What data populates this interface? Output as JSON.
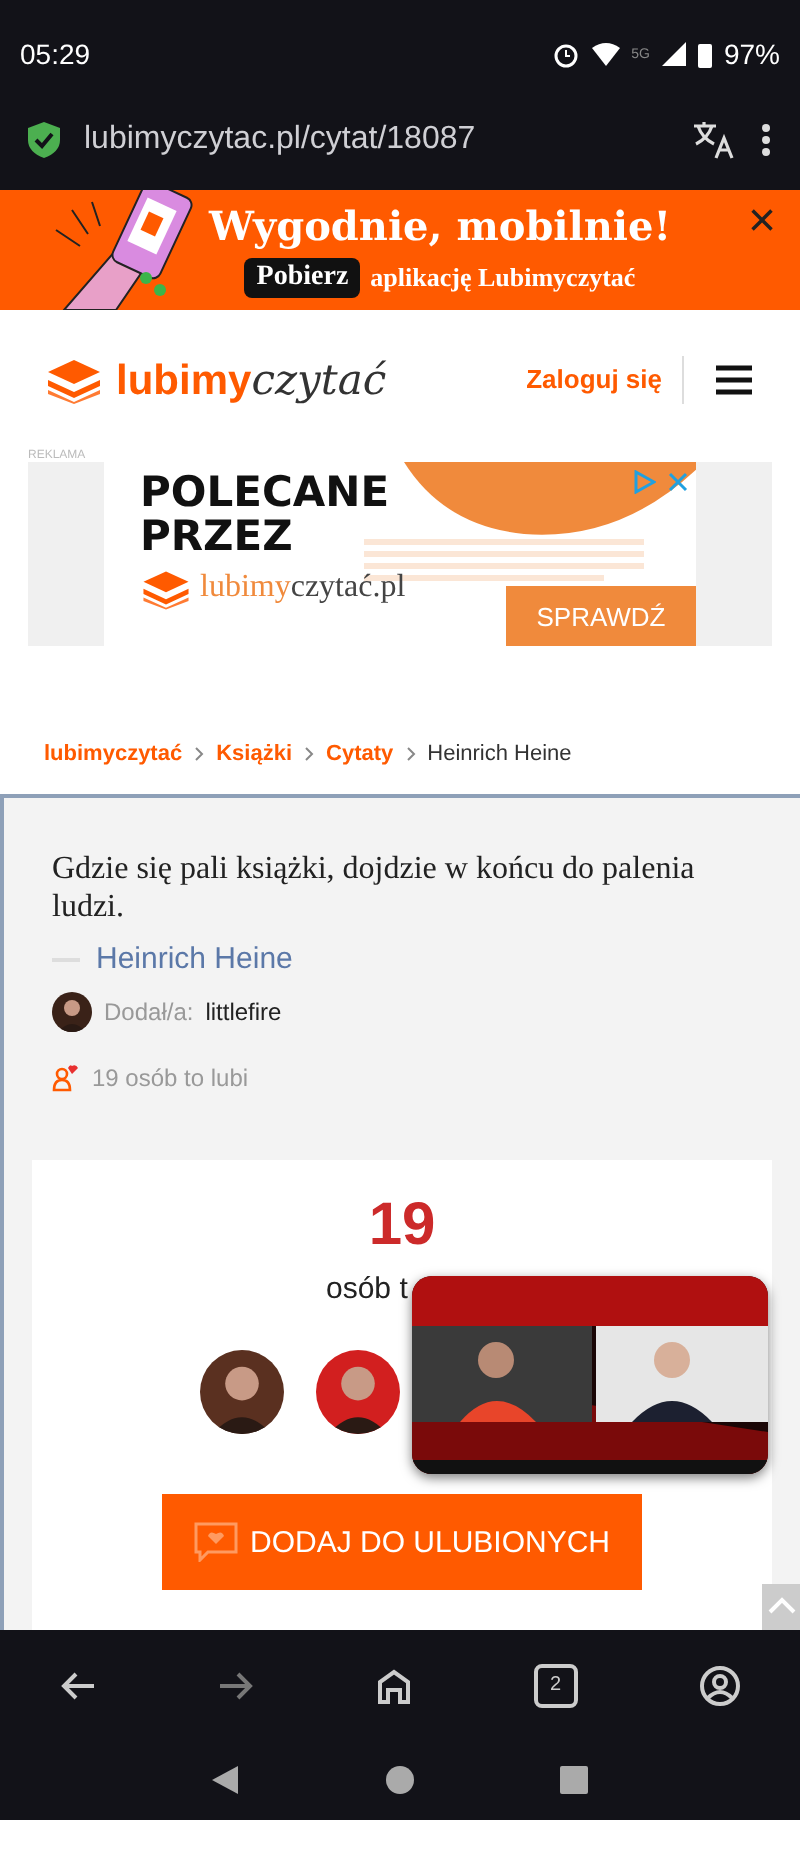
{
  "status_bar": {
    "time": "05:29",
    "network_label": "5G",
    "battery": "97%"
  },
  "browser": {
    "url": "lubimyczytac.pl/cytat/18087"
  },
  "app_banner": {
    "title": "Wygodnie, mobilnie!",
    "button": "Pobierz",
    "subtitle": "aplikację Lubimyczytać",
    "close": "×"
  },
  "header": {
    "logo_main": "lubimy",
    "logo_script": "czytać",
    "login": "Zaloguj się"
  },
  "ad": {
    "label": "REKLAMA",
    "headline": [
      "POLECANE",
      "PRZEZ"
    ],
    "brand_main": "lubimy",
    "brand_script": "czytać.pl",
    "cta": "SPRAWDŹ"
  },
  "breadcrumbs": [
    {
      "label": "lubimyczytać",
      "link": true
    },
    {
      "label": "Książki",
      "link": true
    },
    {
      "label": "Cytaty",
      "link": true
    },
    {
      "label": "Heinrich Heine",
      "link": false
    }
  ],
  "quote": {
    "text": "Gdzie się pali książki, dojdzie w końcu do palenia ludzi.",
    "author": "Heinrich Heine",
    "added_by_label": "Dodał/a:",
    "added_by": "littlefire",
    "likes": "19 osób to lubi"
  },
  "likes_box": {
    "count": "19",
    "caption": "osób t",
    "button": "DODAJ DO ULUBIONYCH"
  },
  "bottom_bar": {
    "tabs_count": "2"
  }
}
